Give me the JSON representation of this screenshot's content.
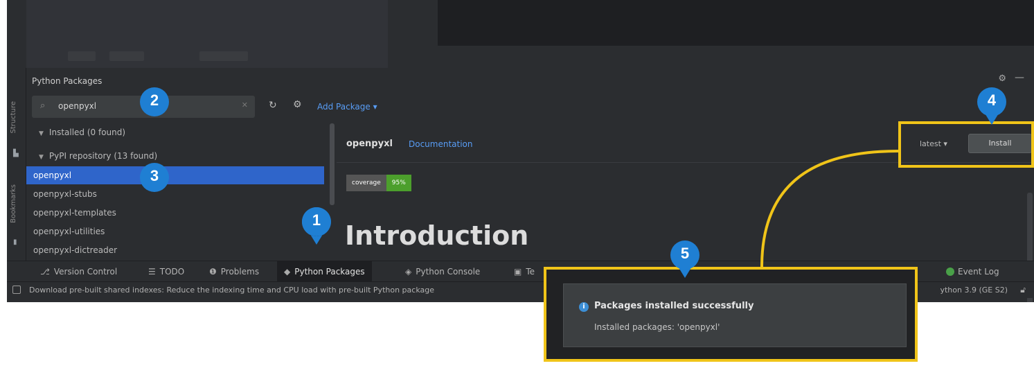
{
  "panel": {
    "title": "Python Packages",
    "gear_icon": "gear-icon",
    "minimize_icon": "minimize-icon"
  },
  "left_strip": {
    "tabs": [
      "Structure",
      "Bookmarks"
    ]
  },
  "search": {
    "value": "openpyxl",
    "icon": "search-icon"
  },
  "toolbar": {
    "add_package_label": "Add Package ▾"
  },
  "tree": {
    "installed_label": "Installed (0 found)",
    "repository_label": "PyPI repository (13 found)",
    "packages": [
      "openpyxl",
      "openpyxl-stubs",
      "openpyxl-templates",
      "openpyxl-utilities",
      "openpyxl-dictreader"
    ]
  },
  "detail": {
    "package_name": "openpyxl",
    "documentation_label": "Documentation",
    "badge_label": "coverage",
    "badge_value": "95%",
    "heading": "Introduction",
    "version_label": "latest ▾",
    "install_label": "Install"
  },
  "bottom_bar": {
    "items": [
      {
        "icon": "⎇",
        "label": "Version Control"
      },
      {
        "icon": "☰",
        "label": "TODO"
      },
      {
        "icon": "❶",
        "label": "Problems"
      },
      {
        "icon": "◆",
        "label": "Python Packages"
      },
      {
        "icon": "◈",
        "label": "Python Console"
      },
      {
        "icon": "▣",
        "label": "Te"
      }
    ],
    "event_log_label": "Event Log"
  },
  "status": {
    "message": "Download pre-built shared indexes: Reduce the indexing time and CPU load with pre-built Python package",
    "interpreter": "ython 3.9 (GE S2)"
  },
  "notification": {
    "title": "Packages installed successfully",
    "body": "Installed packages: 'openpyxl'"
  },
  "markers": [
    "1",
    "2",
    "3",
    "4",
    "5"
  ],
  "colors": {
    "highlight": "#f0c419",
    "marker_blue": "#1f7fd3",
    "selection": "#2f65ca",
    "link": "#589df6"
  }
}
